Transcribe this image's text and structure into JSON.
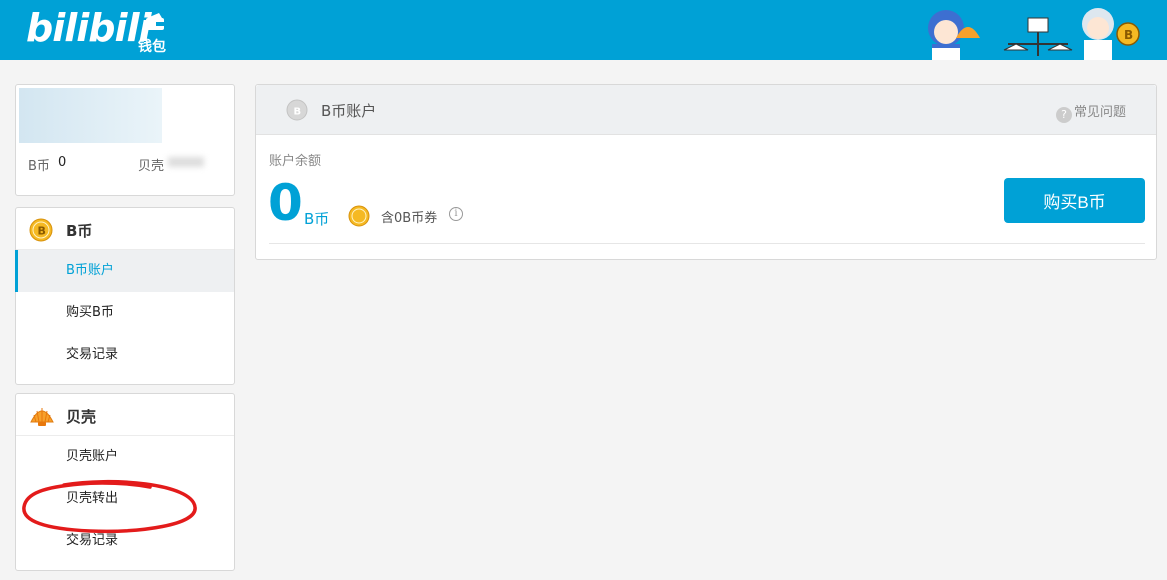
{
  "header": {
    "logo_text": "bilibili",
    "wallet_label": "钱包"
  },
  "user": {
    "bcoin_label": "B币",
    "bcoin_value": "0",
    "shell_label": "贝壳"
  },
  "bcoin_menu": {
    "title": "B币",
    "items": [
      "B币账户",
      "购买B币",
      "交易记录"
    ]
  },
  "shell_menu": {
    "title": "贝壳",
    "items": [
      "贝壳账户",
      "贝壳转出",
      "交易记录"
    ]
  },
  "main": {
    "title": "B币账户",
    "faq_label": "常见问题",
    "balance_label": "账户余额",
    "balance_value": "0",
    "balance_unit": "B币",
    "coupon_text": "含0B币券",
    "buy_button": "购买B币"
  },
  "colors": {
    "brand": "#00a1d6",
    "coin_gold": "#f5b923",
    "annotation_red": "#e31b1b"
  }
}
